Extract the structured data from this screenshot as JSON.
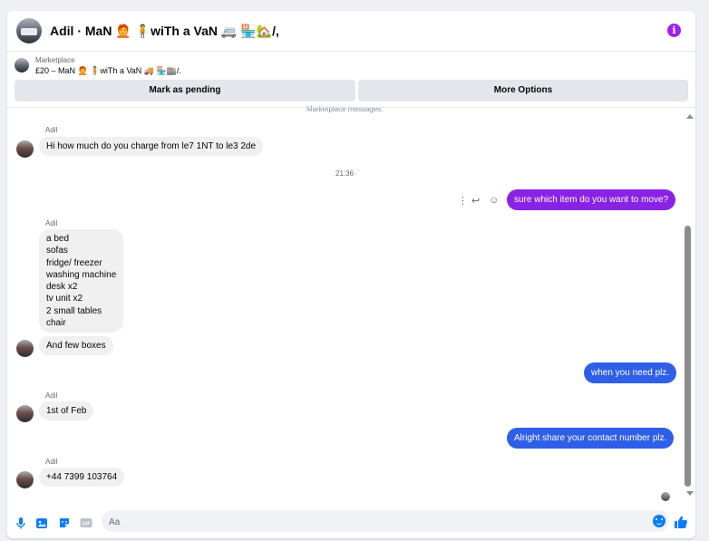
{
  "header": {
    "title": "Adil · MaN 🧑‍🦰 🧍wiTh a VaN 🚐 🏪🏡/,"
  },
  "listing": {
    "category": "Marketplace",
    "name": "£20 – MaN 🧑‍🦰 🧍wiTh a VaN 🚚 🏪🏬/."
  },
  "actions": {
    "pending_label": "Mark as pending",
    "more_label": "More Options"
  },
  "thread": {
    "ghost_text": "Marketplace messages.",
    "timestamp": "21:36",
    "sender_name": "Adil",
    "messages": [
      {
        "from": "them",
        "text": "Hi how much do you charge from le7 1NT to le3 2de"
      },
      {
        "from": "me",
        "text": "sure which item do you want to move?"
      },
      {
        "from": "them",
        "text": "a bed\nsofas\nfridge/ freezer\nwashing machine\ndesk x2\ntv unit x2\n2 small tables\nchair"
      },
      {
        "from": "them",
        "text": "And few boxes"
      },
      {
        "from": "me",
        "text": "when you need plz."
      },
      {
        "from": "them",
        "text": "1st of Feb"
      },
      {
        "from": "me",
        "text": "Alright share your contact number plz."
      },
      {
        "from": "them",
        "text": "+44 7399 103764"
      }
    ]
  },
  "composer": {
    "placeholder": "Aa"
  },
  "colors": {
    "accent": "#0a7cff",
    "bubble_out": "#2f5fe8",
    "bubble_purple": "#8a22e6",
    "info": "#a020f0"
  },
  "icons": [
    "info-icon",
    "more-vertical-icon",
    "reply-icon",
    "emoji-react-icon",
    "microphone-icon",
    "photo-icon",
    "sticker-icon",
    "gif-icon",
    "emoji-icon",
    "thumbs-up-icon"
  ]
}
